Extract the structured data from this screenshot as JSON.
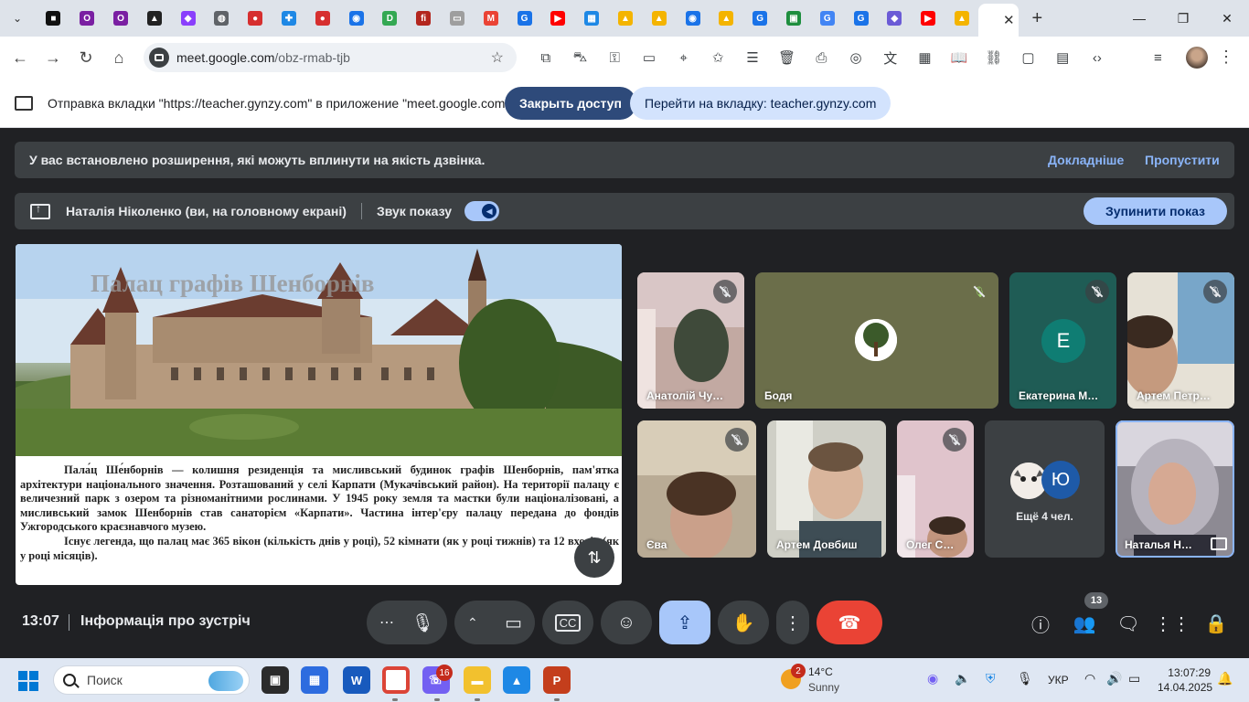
{
  "browser": {
    "tab_favicons": [
      {
        "icon": "notion-icon",
        "color": "#111111",
        "glyph": "■"
      },
      {
        "icon": "opera-icon",
        "color": "#7a1fa2",
        "glyph": "O"
      },
      {
        "icon": "opera-icon",
        "color": "#7a1fa2",
        "glyph": "O"
      },
      {
        "icon": "drive-icon",
        "color": "#222222",
        "glyph": "▲"
      },
      {
        "icon": "extension-icon",
        "color": "#8a3ffc",
        "glyph": "◆"
      },
      {
        "icon": "globe-icon",
        "color": "#5f6368",
        "glyph": "◍"
      },
      {
        "icon": "red-ball-icon",
        "color": "#d62f2f",
        "glyph": "●"
      },
      {
        "icon": "puzzle-icon",
        "color": "#1e88e5",
        "glyph": "✚"
      },
      {
        "icon": "red-ball-icon",
        "color": "#d62f2f",
        "glyph": "●"
      },
      {
        "icon": "shield-icon",
        "color": "#1a73e8",
        "glyph": "◉"
      },
      {
        "icon": "d-icon",
        "color": "#34a853",
        "glyph": "D"
      },
      {
        "icon": "fi-icon",
        "color": "#b3261e",
        "glyph": "fi"
      },
      {
        "icon": "image-icon",
        "color": "#9e9e9e",
        "glyph": "▭"
      },
      {
        "icon": "gmail-icon",
        "color": "#ea4335",
        "glyph": "M"
      },
      {
        "icon": "g-icon",
        "color": "#1a73e8",
        "glyph": "G"
      },
      {
        "icon": "youtube-icon",
        "color": "#ff0000",
        "glyph": "▶"
      },
      {
        "icon": "grid-icon",
        "color": "#1e88e5",
        "glyph": "▦"
      },
      {
        "icon": "bell-icon",
        "color": "#f4b400",
        "glyph": "▲"
      },
      {
        "icon": "bell-icon",
        "color": "#f4b400",
        "glyph": "▲"
      },
      {
        "icon": "shield-icon",
        "color": "#1a73e8",
        "glyph": "◉"
      },
      {
        "icon": "bell-icon",
        "color": "#f4b400",
        "glyph": "▲"
      },
      {
        "icon": "g-icon",
        "color": "#1a73e8",
        "glyph": "G"
      },
      {
        "icon": "classroom-icon",
        "color": "#1e8e3e",
        "glyph": "▣"
      },
      {
        "icon": "google-icon",
        "color": "#4285f4",
        "glyph": "G"
      },
      {
        "icon": "g-icon",
        "color": "#1a73e8",
        "glyph": "G"
      },
      {
        "icon": "gemini-icon",
        "color": "#6b5bd6",
        "glyph": "◆"
      },
      {
        "icon": "youtube-icon",
        "color": "#ff0000",
        "glyph": "▶"
      },
      {
        "icon": "bell-icon",
        "color": "#f4b400",
        "glyph": "▲"
      }
    ],
    "active_tab_icon": "meet-icon",
    "url_host": "meet.google.com",
    "url_path": "/obz-rmab-tjb"
  },
  "share_bar": {
    "message": "Отправка вкладки \"https://teacher.gynzy.com\" в приложение \"meet.google.com\"...",
    "close_access": "Закрыть доступ",
    "go_to_tab": "Перейти на вкладку: teacher.gynzy.com"
  },
  "banner": {
    "text": "У вас встановлено розширення, які можуть вплинути на якість дзвінка.",
    "learn_more": "Докладніше",
    "skip": "Пропустити"
  },
  "presenting": {
    "presenter": "Наталія Ніколенко (ви, на головному екрані)",
    "sound_label": "Звук показу",
    "sound_on": true,
    "stop_label": "Зупинити показ"
  },
  "slide": {
    "title": "Палац графів Шенборнів",
    "paragraph1": "Пала́ц Ше́нборнів — колишня резиденція та мисливський будинок графів Шенборнів, пам'ятка архітектури національного значення. Розташований у селі Карпати (Мукачівський район). На території палацу є величезний парк з озером та різноманітними рослинами. У 1945 року земля та мастки були націоналізовані, а мисливський замок Шенборнів став санаторієм «Карпати». Частина інтер'єру палацу передана до фондів Ужгородського краєзнавчого музею.",
    "paragraph2": "Існує легенда, що палац має 365 вікон (кількість днів у році), 52 кімнати (як у році тижнів) та 12 входів (як у році місяців)."
  },
  "participants": [
    {
      "name": "Анатолій Чу…",
      "muted": true,
      "kind": "video",
      "bg": "#b9a39a"
    },
    {
      "name": "Бодя",
      "muted": true,
      "kind": "avatar",
      "bg": "#6b6e4a",
      "avatar_color": "#ffffff"
    },
    {
      "name": "Екатерина М…",
      "muted": true,
      "kind": "letter",
      "letter": "Е",
      "bg": "#1f5c55",
      "avatar_color": "#0f7d73"
    },
    {
      "name": "Артем Петр…",
      "muted": true,
      "kind": "video",
      "bg": "#c9c2a9"
    },
    {
      "name": "Єва",
      "muted": true,
      "kind": "video",
      "bg": "#8c7f6c"
    },
    {
      "name": "Артем Довбиш",
      "muted": false,
      "kind": "video",
      "bg": "#a9a9a0"
    },
    {
      "name": "Олег С…",
      "muted": true,
      "kind": "video",
      "bg": "#d4b8c2"
    },
    {
      "name": "Наталья Н…",
      "muted": false,
      "kind": "self",
      "bg": "#8d8a93"
    }
  ],
  "more_people": {
    "label": "Ещё 4 чел.",
    "letter": "Ю",
    "letter_color": "#1e5aa8"
  },
  "controls": {
    "time": "13:07",
    "meeting_info": "Інформація про зустріч",
    "people_count": "13"
  },
  "taskbar": {
    "search_label": "Поиск",
    "viber_badge": "16",
    "weather_badge": "2",
    "temp": "14°C",
    "condition": "Sunny",
    "lang": "УКР",
    "time": "13:07:29",
    "date": "14.04.2025"
  }
}
